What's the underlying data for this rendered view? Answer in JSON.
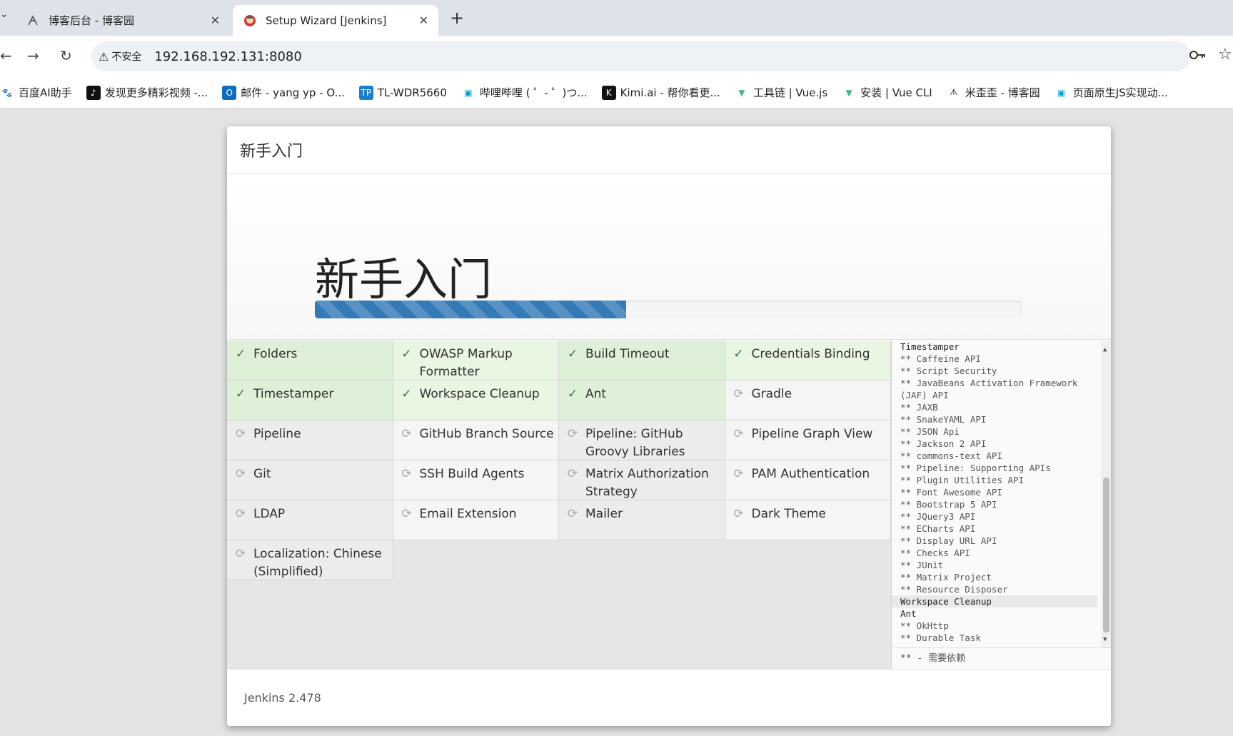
{
  "browser": {
    "tabs": [
      {
        "title": "博客后台 - 博客园",
        "active": false
      },
      {
        "title": "Setup Wizard [Jenkins]",
        "active": true
      }
    ],
    "close_glyph": "✕",
    "newtab_glyph": "+",
    "security_label": "不安全",
    "url": "192.168.192.131:8080",
    "bookmarks": [
      {
        "label": "百度AI助手",
        "icon": "baidu-paw-icon",
        "color": "#2b5cd8"
      },
      {
        "label": "发现更多精彩视频 -...",
        "icon": "douyin-icon",
        "color": "#111111"
      },
      {
        "label": "邮件 - yang yp - O...",
        "icon": "outlook-icon",
        "color": "#0f6cbd"
      },
      {
        "label": "TL-WDR5660",
        "icon": "tplink-icon",
        "color": "#1b7fd1"
      },
      {
        "label": "哔哩哔哩 ( ゜- ゜)つ...",
        "icon": "bilibili-icon",
        "color": "#00a1d6"
      },
      {
        "label": "Kimi.ai - 帮你看更...",
        "icon": "kimi-icon",
        "color": "#111111"
      },
      {
        "label": "工具链 | Vue.js",
        "icon": "vue-icon",
        "color": "#41b883"
      },
      {
        "label": "安装 | Vue CLI",
        "icon": "vue-icon",
        "color": "#41b883"
      },
      {
        "label": "米歪歪 - 博客园",
        "icon": "cnblogs-icon",
        "color": "#555555"
      },
      {
        "label": "页面原生JS实现动...",
        "icon": "bilibili-icon",
        "color": "#00a1d6"
      }
    ]
  },
  "wizard": {
    "header_title": "新手入门",
    "hero_title": "新手入门",
    "progress_fraction": 0.44,
    "plugins": [
      {
        "name": "Folders",
        "status": "success"
      },
      {
        "name": "OWASP Markup Formatter",
        "status": "success"
      },
      {
        "name": "Build Timeout",
        "status": "success"
      },
      {
        "name": "Credentials Binding",
        "status": "success"
      },
      {
        "name": "Timestamper",
        "status": "success"
      },
      {
        "name": "Workspace Cleanup",
        "status": "success"
      },
      {
        "name": "Ant",
        "status": "success"
      },
      {
        "name": "Gradle",
        "status": "pending"
      },
      {
        "name": "Pipeline",
        "status": "pending"
      },
      {
        "name": "GitHub Branch Source",
        "status": "pending"
      },
      {
        "name": "Pipeline: GitHub Groovy Libraries",
        "status": "pending"
      },
      {
        "name": "Pipeline Graph View",
        "status": "pending"
      },
      {
        "name": "Git",
        "status": "pending"
      },
      {
        "name": "SSH Build Agents",
        "status": "pending"
      },
      {
        "name": "Matrix Authorization Strategy",
        "status": "pending"
      },
      {
        "name": "PAM Authentication",
        "status": "pending"
      },
      {
        "name": "LDAP",
        "status": "pending"
      },
      {
        "name": "Email Extension",
        "status": "pending"
      },
      {
        "name": "Mailer",
        "status": "pending"
      },
      {
        "name": "Dark Theme",
        "status": "pending"
      },
      {
        "name": "Localization: Chinese (Simplified)",
        "status": "pending"
      }
    ],
    "status_glyphs": {
      "success": "✓",
      "pending": "⟳"
    },
    "log_lines": [
      {
        "text": "Timestamper",
        "kind": "head"
      },
      {
        "text": "** Caffeine API",
        "kind": "dep"
      },
      {
        "text": "** Script Security",
        "kind": "dep"
      },
      {
        "text": "** JavaBeans Activation Framework",
        "kind": "dep"
      },
      {
        "text": "(JAF) API",
        "kind": "dep"
      },
      {
        "text": "** JAXB",
        "kind": "dep"
      },
      {
        "text": "** SnakeYAML API",
        "kind": "dep"
      },
      {
        "text": "** JSON Api",
        "kind": "dep"
      },
      {
        "text": "** Jackson 2 API",
        "kind": "dep"
      },
      {
        "text": "** commons-text API",
        "kind": "dep"
      },
      {
        "text": "** Pipeline: Supporting APIs",
        "kind": "dep"
      },
      {
        "text": "** Plugin Utilities API",
        "kind": "dep"
      },
      {
        "text": "** Font Awesome API",
        "kind": "dep"
      },
      {
        "text": "** Bootstrap 5 API",
        "kind": "dep"
      },
      {
        "text": "** JQuery3 API",
        "kind": "dep"
      },
      {
        "text": "** ECharts API",
        "kind": "dep"
      },
      {
        "text": "** Display URL API",
        "kind": "dep"
      },
      {
        "text": "** Checks API",
        "kind": "dep"
      },
      {
        "text": "** JUnit",
        "kind": "dep"
      },
      {
        "text": "** Matrix Project",
        "kind": "dep"
      },
      {
        "text": "** Resource Disposer",
        "kind": "dep"
      },
      {
        "text": "Workspace Cleanup",
        "kind": "head-hl"
      },
      {
        "text": "Ant",
        "kind": "head"
      },
      {
        "text": "** OkHttp",
        "kind": "dep"
      },
      {
        "text": "** Durable Task",
        "kind": "dep"
      }
    ],
    "log_legend": "** - 需要依赖",
    "footer_version": "Jenkins 2.478"
  }
}
